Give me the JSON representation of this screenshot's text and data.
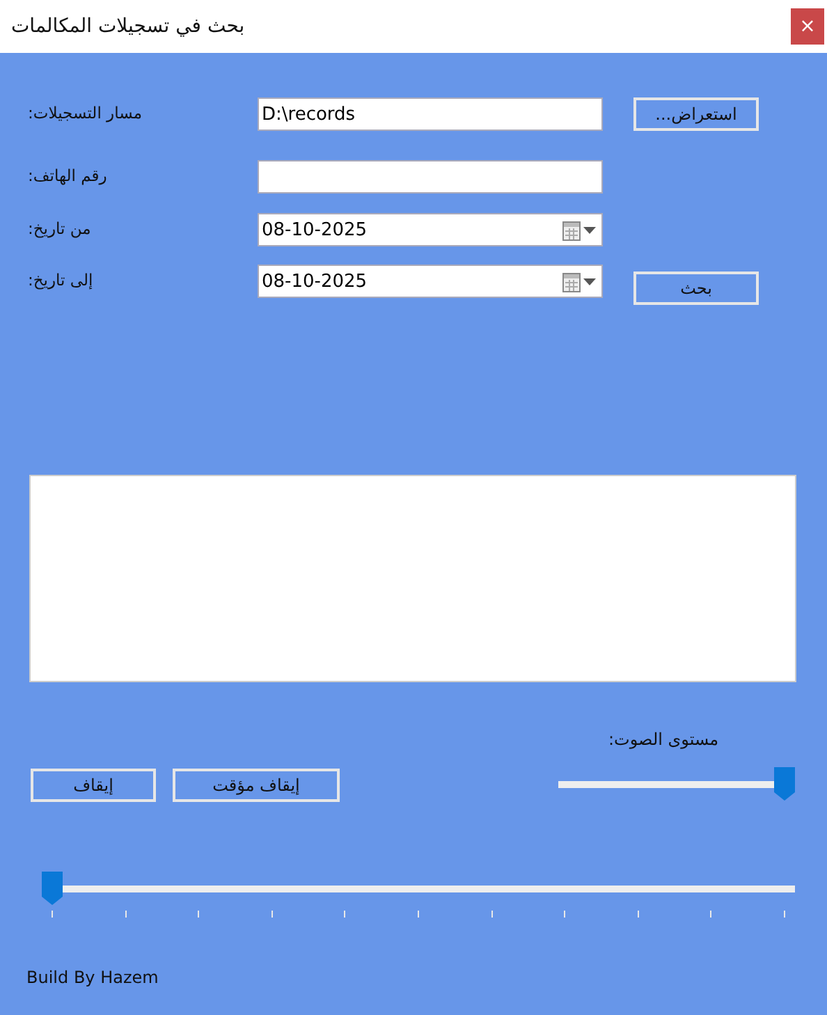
{
  "window": {
    "title": "بحث في تسجيلات المكالمات",
    "close": "×"
  },
  "form_rows": [
    {
      "label": "مسار التسجيلات:",
      "kind": "text",
      "value": "D:\\records",
      "button": "استعراض..."
    },
    {
      "label": "رقم الهاتف:",
      "kind": "text",
      "value": ""
    },
    {
      "label": "من تاريخ:",
      "kind": "date",
      "value": "08-10-2025"
    },
    {
      "label": "إلى تاريخ:",
      "kind": "date",
      "value": "08-10-2025",
      "button": "بحث"
    }
  ],
  "volume": {
    "label": "مستوى الصوت:",
    "level": 1
  },
  "playback_buttons": [
    "إيقاف مؤقت",
    "إيقاف"
  ],
  "seek": {
    "level": 0
  },
  "footer": "Build By Hazem"
}
